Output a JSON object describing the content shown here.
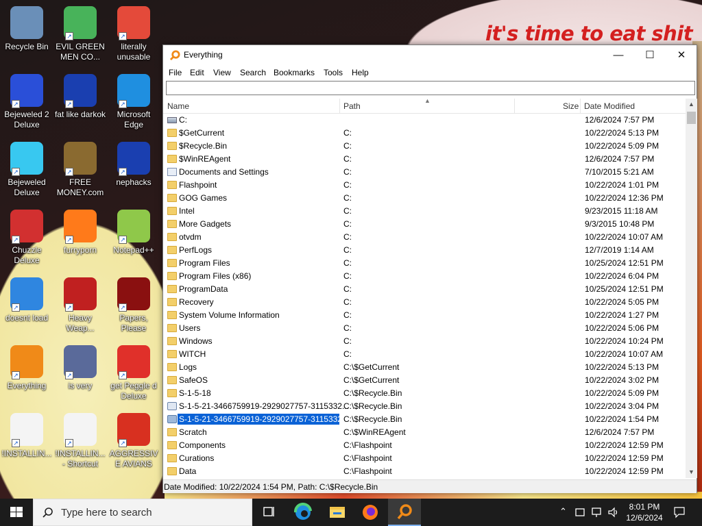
{
  "wallpaper": {
    "caption": "it's time to eat shit"
  },
  "desktop_icons": [
    {
      "label": "Recycle Bin",
      "icon": "recycle-bin-icon"
    },
    {
      "label": "EVIL GREEN MEN CO...",
      "icon": "green-men-icon"
    },
    {
      "label": "literally unusable",
      "icon": "chrome-icon"
    },
    {
      "label": "Bejeweled 2 Deluxe",
      "icon": "bejeweled2-icon"
    },
    {
      "label": "fat like darkok",
      "icon": "mpi-icon"
    },
    {
      "label": "Microsoft Edge",
      "icon": "edge-icon"
    },
    {
      "label": "Bejeweled Deluxe",
      "icon": "bejeweled-icon"
    },
    {
      "label": "FREE MONEY.com",
      "icon": "money-bag-icon"
    },
    {
      "label": "nephacks",
      "icon": "mpi-icon"
    },
    {
      "label": "Chuzzle Deluxe",
      "icon": "chuzzle-icon"
    },
    {
      "label": "furryporn",
      "icon": "firefox-icon"
    },
    {
      "label": "Notepad++",
      "icon": "notepad-plus-plus-icon"
    },
    {
      "label": "doesnt load",
      "icon": "thunderbird-icon"
    },
    {
      "label": "Heavy Weap...",
      "icon": "heavy-weapon-icon"
    },
    {
      "label": "Papers, Please",
      "icon": "papers-please-icon"
    },
    {
      "label": "Everything",
      "icon": "everything-search-icon"
    },
    {
      "label": "is very",
      "icon": "mpi-shield-icon"
    },
    {
      "label": "get Peggle d Deluxe",
      "icon": "peggle-icon"
    },
    {
      "label": "!INSTALLIN...",
      "icon": "document-icon"
    },
    {
      "label": "!INSTALLIN... - Shortcut",
      "icon": "document-shortcut-icon"
    },
    {
      "label": "AGGRESSIVE AVIANS",
      "icon": "angry-birds-icon"
    }
  ],
  "window": {
    "title": "Everything",
    "menu": [
      "File",
      "Edit",
      "View",
      "Search",
      "Bookmarks",
      "Tools",
      "Help"
    ],
    "search_value": "",
    "columns": [
      "Name",
      "Path",
      "Size",
      "Date Modified"
    ],
    "rows": [
      {
        "name": "C:",
        "path": "",
        "date": "12/6/2024 7:57 PM",
        "icon": "drive"
      },
      {
        "name": "$GetCurrent",
        "path": "C:",
        "date": "10/22/2024 5:13 PM",
        "icon": "folder"
      },
      {
        "name": "$Recycle.Bin",
        "path": "C:",
        "date": "10/22/2024 5:09 PM",
        "icon": "folder"
      },
      {
        "name": "$WinREAgent",
        "path": "C:",
        "date": "12/6/2024 7:57 PM",
        "icon": "folder"
      },
      {
        "name": "Documents and Settings",
        "path": "C:",
        "date": "7/10/2015 5:21 AM",
        "icon": "shortcut"
      },
      {
        "name": "Flashpoint",
        "path": "C:",
        "date": "10/22/2024 1:01 PM",
        "icon": "folder"
      },
      {
        "name": "GOG Games",
        "path": "C:",
        "date": "10/22/2024 12:36 PM",
        "icon": "folder"
      },
      {
        "name": "Intel",
        "path": "C:",
        "date": "9/23/2015 11:18 AM",
        "icon": "folder"
      },
      {
        "name": "More Gadgets",
        "path": "C:",
        "date": "9/3/2015 10:48 PM",
        "icon": "folder"
      },
      {
        "name": "otvdm",
        "path": "C:",
        "date": "10/22/2024 10:07 AM",
        "icon": "folder"
      },
      {
        "name": "PerfLogs",
        "path": "C:",
        "date": "12/7/2019 1:14 AM",
        "icon": "folder"
      },
      {
        "name": "Program Files",
        "path": "C:",
        "date": "10/25/2024 12:51 PM",
        "icon": "folder"
      },
      {
        "name": "Program Files (x86)",
        "path": "C:",
        "date": "10/22/2024 6:04 PM",
        "icon": "folder"
      },
      {
        "name": "ProgramData",
        "path": "C:",
        "date": "10/25/2024 12:51 PM",
        "icon": "folder"
      },
      {
        "name": "Recovery",
        "path": "C:",
        "date": "10/22/2024 5:05 PM",
        "icon": "folder"
      },
      {
        "name": "System Volume Information",
        "path": "C:",
        "date": "10/22/2024 1:27 PM",
        "icon": "folder"
      },
      {
        "name": "Users",
        "path": "C:",
        "date": "10/22/2024 5:06 PM",
        "icon": "folder"
      },
      {
        "name": "Windows",
        "path": "C:",
        "date": "10/22/2024 10:24 PM",
        "icon": "folder"
      },
      {
        "name": "WITCH",
        "path": "C:",
        "date": "10/22/2024 10:07 AM",
        "icon": "folder"
      },
      {
        "name": "Logs",
        "path": "C:\\$GetCurrent",
        "date": "10/22/2024 5:13 PM",
        "icon": "folder"
      },
      {
        "name": "SafeOS",
        "path": "C:\\$GetCurrent",
        "date": "10/22/2024 3:02 PM",
        "icon": "folder"
      },
      {
        "name": "S-1-5-18",
        "path": "C:\\$Recycle.Bin",
        "date": "10/22/2024 5:09 PM",
        "icon": "folder"
      },
      {
        "name": "S-1-5-21-3466759919-2929027757-3115332...",
        "path": "C:\\$Recycle.Bin",
        "date": "10/22/2024 3:04 PM",
        "icon": "recycle"
      },
      {
        "name": "S-1-5-21-3466759919-2929027757-3115332...",
        "path": "C:\\$Recycle.Bin",
        "date": "10/22/2024 1:54 PM",
        "icon": "recycle",
        "selected": true
      },
      {
        "name": "Scratch",
        "path": "C:\\$WinREAgent",
        "date": "12/6/2024 7:57 PM",
        "icon": "folder"
      },
      {
        "name": "Components",
        "path": "C:\\Flashpoint",
        "date": "10/22/2024 12:59 PM",
        "icon": "folder"
      },
      {
        "name": "Curations",
        "path": "C:\\Flashpoint",
        "date": "10/22/2024 12:59 PM",
        "icon": "folder"
      },
      {
        "name": "Data",
        "path": "C:\\Flashpoint",
        "date": "10/22/2024 12:59 PM",
        "icon": "folder"
      }
    ],
    "status": "Date Modified: 10/22/2024 1:54 PM, Path: C:\\$Recycle.Bin"
  },
  "taskbar": {
    "search_placeholder": "Type here to search",
    "apps": [
      "task-view-icon",
      "edge-icon",
      "file-explorer-icon",
      "firefox-icon",
      "everything-search-icon"
    ],
    "time": "8:01 PM",
    "date": "12/6/2024"
  },
  "colors": {
    "selection": "#0a62d6",
    "folder": "#f3cf6a",
    "wall_text": "#d42020",
    "taskbar": "#1c1c1c"
  }
}
